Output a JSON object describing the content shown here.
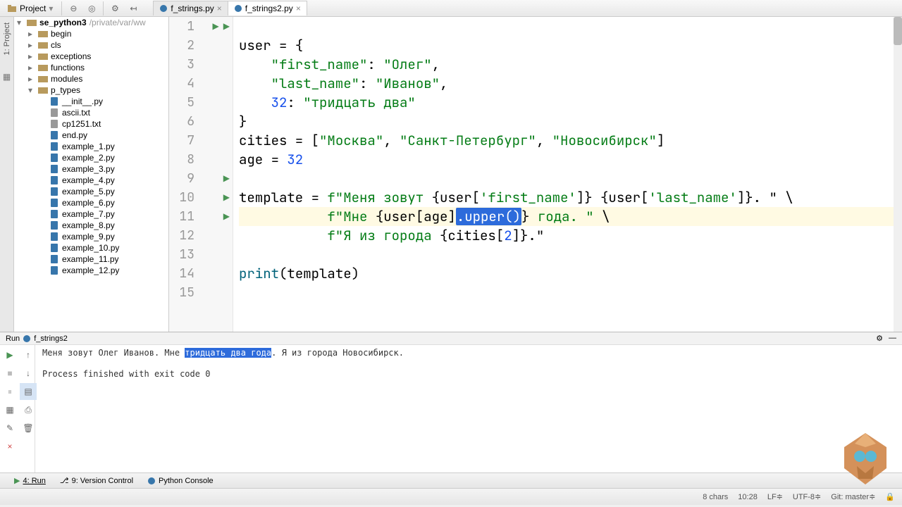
{
  "toolbar": {
    "project_label": "Project"
  },
  "tabs": [
    {
      "name": "f_strings.py",
      "active": false
    },
    {
      "name": "f_strings2.py",
      "active": true
    }
  ],
  "side_tabs": {
    "project": "1: Project"
  },
  "tree": {
    "root": {
      "name": "se_python3",
      "path": "/private/var/ww"
    },
    "folders": [
      "begin",
      "cls",
      "exceptions",
      "functions",
      "modules"
    ],
    "ptypes_label": "p_types",
    "files": [
      "__init__.py",
      "ascii.txt",
      "cp1251.txt",
      "end.py",
      "example_1.py",
      "example_2.py",
      "example_3.py",
      "example_4.py",
      "example_5.py",
      "example_6.py",
      "example_7.py",
      "example_8.py",
      "example_9.py",
      "example_10.py",
      "example_11.py",
      "example_12.py"
    ]
  },
  "code": {
    "lines": [
      "1",
      "2",
      "3",
      "4",
      "5",
      "6",
      "7",
      "8",
      "9",
      "10",
      "11",
      "12",
      "13",
      "14",
      "15"
    ],
    "l1a": "user = {",
    "l2a": "    ",
    "l2b": "\"first_name\"",
    "l2c": ": ",
    "l2d": "\"Олег\"",
    "l2e": ",",
    "l3a": "    ",
    "l3b": "\"last_name\"",
    "l3c": ": ",
    "l3d": "\"Иванов\"",
    "l3e": ",",
    "l4a": "    ",
    "l4b": "32",
    "l4c": ": ",
    "l4d": "\"тридцать два\"",
    "l5a": "}",
    "l6a": "cities = [",
    "l6b": "\"Москва\"",
    "l6c": ", ",
    "l6d": "\"Санкт-Петербург\"",
    "l6e": ", ",
    "l6f": "\"Новосибирск\"",
    "l6g": "]",
    "l7a": "age = ",
    "l7b": "32",
    "l9a": "template = ",
    "l9b": "f\"Меня зовут ",
    "l9c": "{user[",
    "l9d": "'first_name'",
    "l9e": "]} {user[",
    "l9f": "'last_name'",
    "l9g": "]}. \"",
    "l9h": " \\",
    "l10a": "           ",
    "l10b": "f\"Мне ",
    "l10c": "{user[age]",
    "l10sel": ".upper()",
    "l10d": "}",
    " l10e": " года. \"",
    "l10f": " \\",
    "l11a": "           ",
    "l11b": "f\"Я из города ",
    "l11c": "{cities[",
    "l11d": "2",
    "l11e": "]}.\"",
    "l13a": "print",
    "l13b": "(template)"
  },
  "run": {
    "title_prefix": "Run",
    "title": "f_strings2",
    "out1a": "Меня зовут Олег Иванов. Мне ",
    "out1b": "тридцать два года",
    "out1c": ". Я из города Новосибирск.",
    "out2": "Process finished with exit code 0"
  },
  "bottom": {
    "run": "4: Run",
    "vcs": "9: Version Control",
    "console": "Python Console"
  },
  "status": {
    "chars": "8 chars",
    "time": "10:28",
    "lf": "LF≑",
    "enc": "UTF-8≑",
    "git": "Git: master≑",
    "lock": "🔒"
  }
}
